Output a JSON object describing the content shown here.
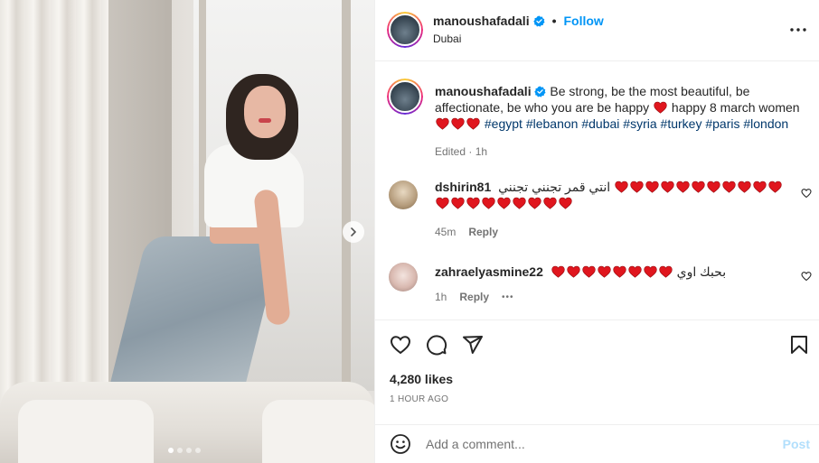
{
  "post": {
    "username": "manoushafadali",
    "separator": "•",
    "follow_label": "Follow",
    "location": "Dubai",
    "more_icon": "more-horizontal-icon"
  },
  "caption": {
    "username": "manoushafadali",
    "text_part1": "Be strong, be the most beautiful, be affectionate, be who you are be happy",
    "text_part2": "happy 8 march women",
    "tags": [
      "#egypt",
      "#lebanon",
      "#dubai",
      "#syria",
      "#turkey",
      "#paris",
      "#london"
    ],
    "meta": "Edited · 1h"
  },
  "comments": [
    {
      "username": "dshirin81",
      "text": "انتي قمر تجنني تجنني",
      "heart_count": 20,
      "time": "45m",
      "reply_label": "Reply"
    },
    {
      "username": "zahraelyasmine22",
      "text": "بحبك اوي",
      "heart_count": 8,
      "time": "1h",
      "reply_label": "Reply",
      "more": "•••"
    }
  ],
  "likes": "4,280 likes",
  "time_ago": "1 HOUR AGO",
  "add_comment": {
    "placeholder": "Add a comment...",
    "post_label": "Post"
  },
  "carousel": {
    "total": 4,
    "active": 1
  },
  "colors": {
    "accent": "#0095f6",
    "tag": "#00376b",
    "heart": "#e0161e",
    "post_disabled": "#b2dffc"
  }
}
